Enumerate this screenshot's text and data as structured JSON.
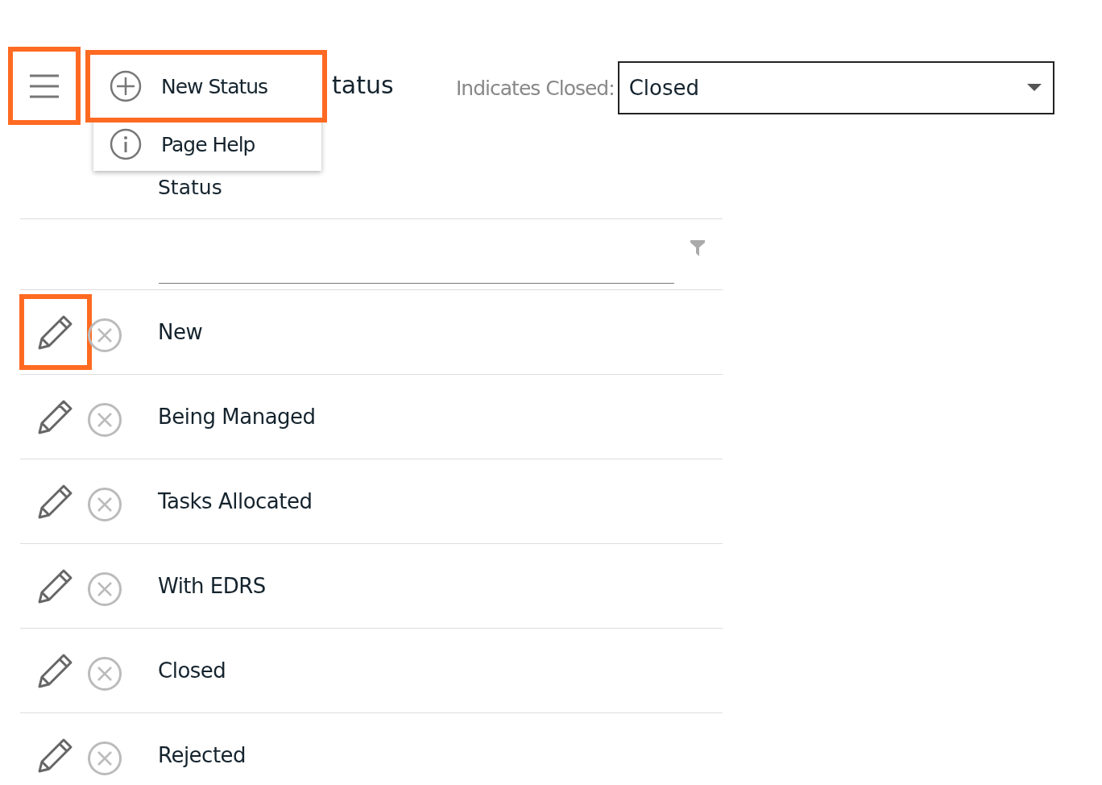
{
  "menu_button": {
    "highlighted": true
  },
  "menu": {
    "items": [
      {
        "kind": "add",
        "label": "New Status",
        "highlighted": true
      },
      {
        "kind": "info",
        "label": "Page Help",
        "highlighted": false
      }
    ]
  },
  "title": "tatus",
  "closed_field": {
    "label": "Indicates Closed:",
    "value": "Closed"
  },
  "table": {
    "columns": [
      "Status"
    ],
    "rows": [
      {
        "status": "New",
        "edit_highlighted": true
      },
      {
        "status": "Being Managed",
        "edit_highlighted": false
      },
      {
        "status": "Tasks Allocated",
        "edit_highlighted": false
      },
      {
        "status": "With EDRS",
        "edit_highlighted": false
      },
      {
        "status": "Closed",
        "edit_highlighted": false
      },
      {
        "status": "Rejected",
        "edit_highlighted": false
      }
    ]
  }
}
